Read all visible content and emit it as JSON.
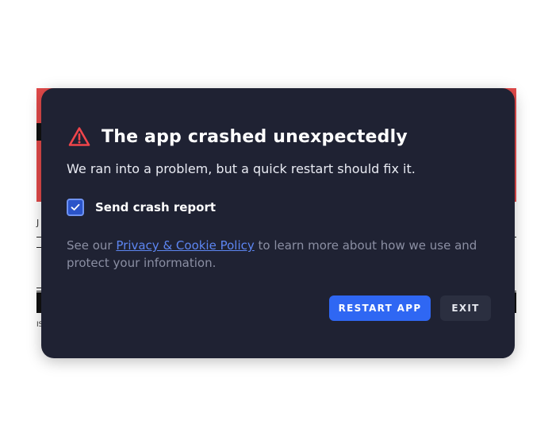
{
  "dialog": {
    "title": "The app crashed unexpectedly",
    "subtitle": "We ran into a problem, but a quick restart should fix it.",
    "icon": "warning-triangle-icon",
    "checkbox": {
      "label": "Send crash report",
      "checked": true
    },
    "policy": {
      "prefix": "See our ",
      "link_text": "Privacy & Cookie Policy",
      "suffix": " to learn more about how we use and protect your information."
    },
    "buttons": {
      "restart": "RESTART APP",
      "exit": "EXIT"
    }
  },
  "colors": {
    "dialog_bg": "#1f2233",
    "warning": "#f0454b",
    "primary": "#2f67f3",
    "link": "#5d86f2",
    "backdrop_accent": "#e24a4a"
  },
  "background": {
    "glyph_a": "J",
    "glyph_b": "IS"
  }
}
